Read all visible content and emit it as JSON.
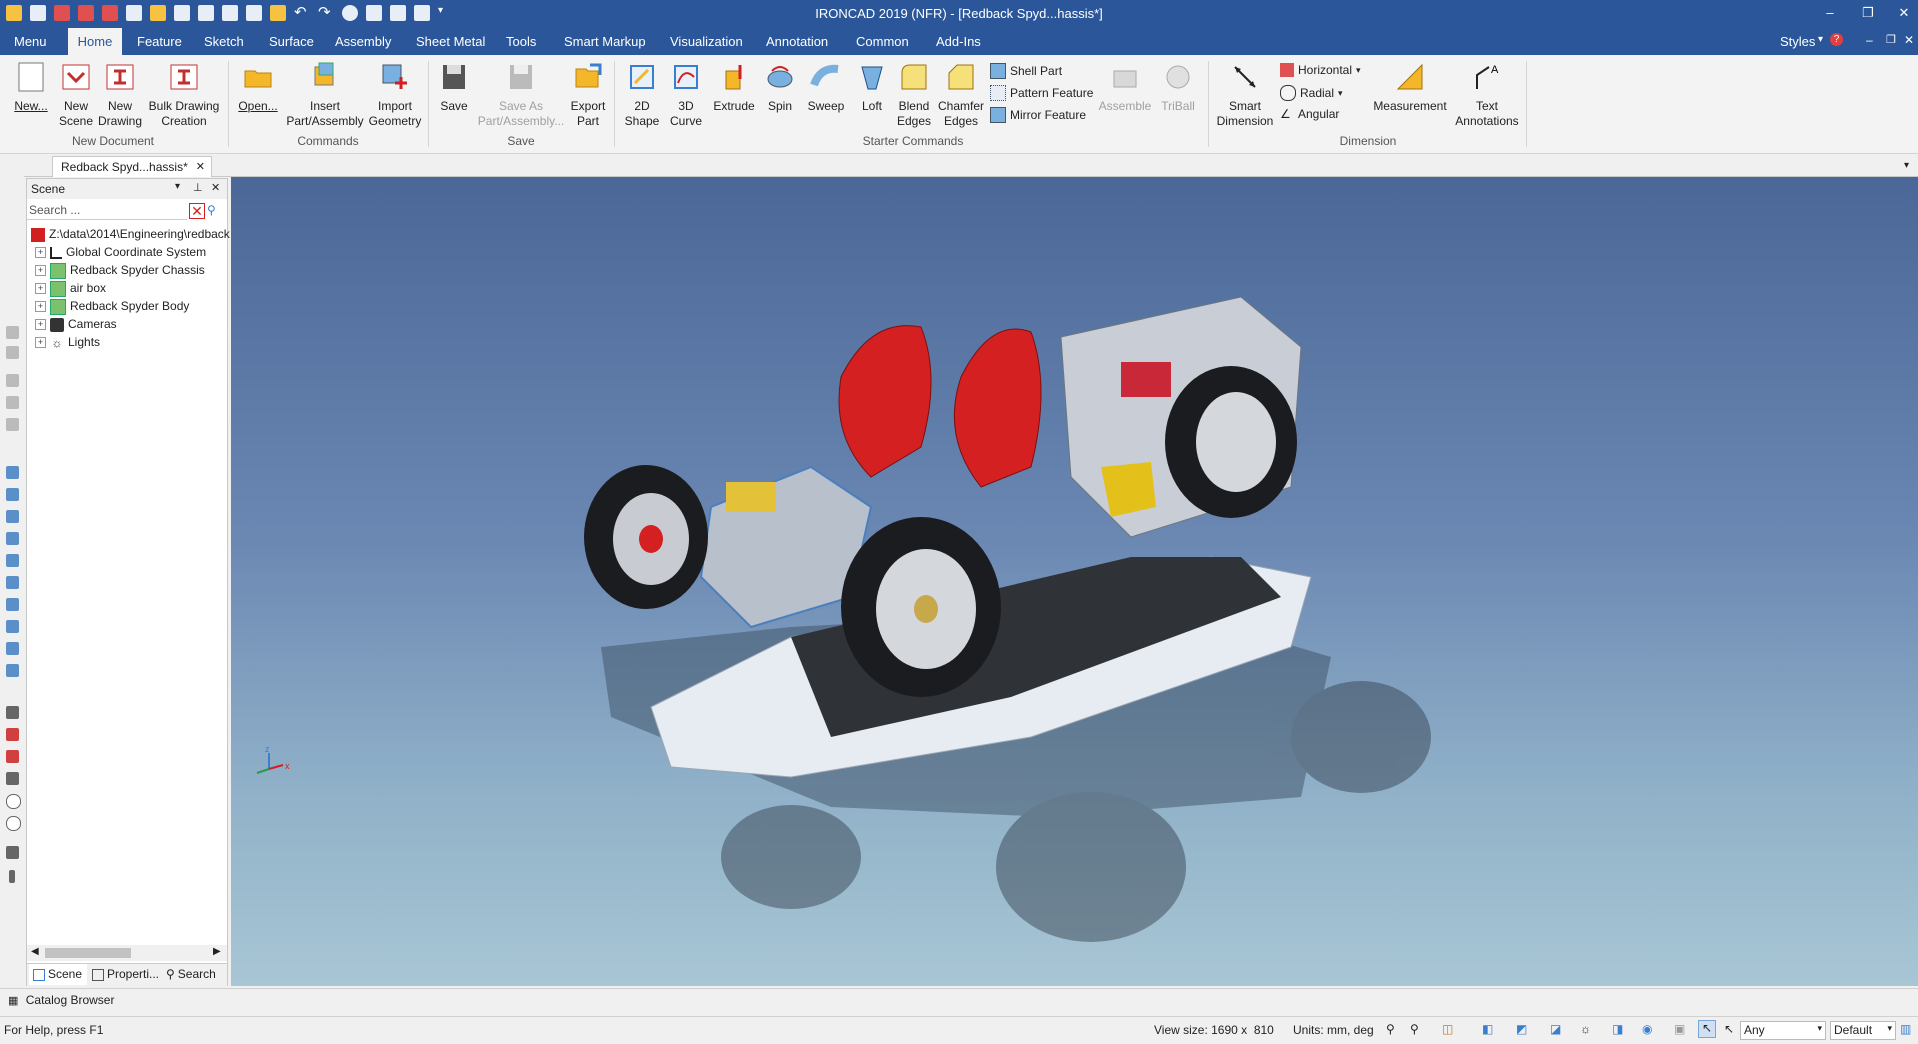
{
  "window": {
    "title": "IRONCAD 2019 (NFR) - [Redback Spyd...hassis*]"
  },
  "ribbon_tabs": [
    "Menu",
    "Home",
    "Feature",
    "Sketch",
    "Surface",
    "Assembly",
    "Sheet Metal",
    "Tools",
    "Smart Markup",
    "Visualization",
    "Annotation",
    "Common",
    "Add-Ins"
  ],
  "styles_label": "Styles",
  "ribbon": {
    "new": "New...",
    "new_scene_1": "New",
    "new_scene_2": "Scene",
    "new_drawing_1": "New",
    "new_drawing_2": "Drawing",
    "bulk_1": "Bulk Drawing",
    "bulk_2": "Creation",
    "open": "Open...",
    "insert_1": "Insert",
    "insert_2": "Part/Assembly",
    "import_1": "Import",
    "import_2": "Geometry",
    "save": "Save",
    "saveas_1": "Save As",
    "saveas_2": "Part/Assembly...",
    "export_1": "Export",
    "export_2": "Part",
    "shape2d_1": "2D",
    "shape2d_2": "Shape",
    "curve3d_1": "3D",
    "curve3d_2": "Curve",
    "extrude": "Extrude",
    "spin": "Spin",
    "sweep": "Sweep",
    "loft": "Loft",
    "blend_1": "Blend",
    "blend_2": "Edges",
    "chamfer_1": "Chamfer",
    "chamfer_2": "Edges",
    "shell_part": "Shell Part",
    "pattern_feature": "Pattern Feature",
    "mirror_feature": "Mirror Feature",
    "assemble": "Assemble",
    "triball": "TriBall",
    "smart_dim_1": "Smart",
    "smart_dim_2": "Dimension",
    "horizontal": "Horizontal",
    "radial": "Radial",
    "angular": "Angular",
    "measurement": "Measurement",
    "text_ann_1": "Text",
    "text_ann_2": "Annotations",
    "groups": {
      "new_document": "New Document",
      "commands": "Commands",
      "save": "Save",
      "starter_commands": "Starter Commands",
      "dimension": "Dimension"
    }
  },
  "document_tab": "Redback Spyd...hassis*",
  "scene_panel": {
    "title": "Scene",
    "search_placeholder": "Search ...",
    "root_path": "Z:\\data\\2014\\Engineering\\redback",
    "items": [
      "Global Coordinate System",
      "Redback Spyder Chassis",
      "air box",
      "Redback Spyder Body",
      "Cameras",
      "Lights"
    ],
    "bottom_tabs": [
      "Scene",
      "Properti...",
      "Search"
    ]
  },
  "catalog_browser": "Catalog Browser",
  "status": {
    "help": "For Help, press F1",
    "view_size": "View size: 1690 x  810",
    "units": "Units: mm, deg",
    "filter_any": "Any",
    "default": "Default"
  },
  "colors": {
    "titlebar": "#2b579a",
    "seat": "#d42020",
    "spring": "#e3c23a",
    "airbox": "#e4c11a",
    "frame": "#3a7fcf"
  },
  "axis_labels": {
    "z": "z",
    "x": "x"
  }
}
